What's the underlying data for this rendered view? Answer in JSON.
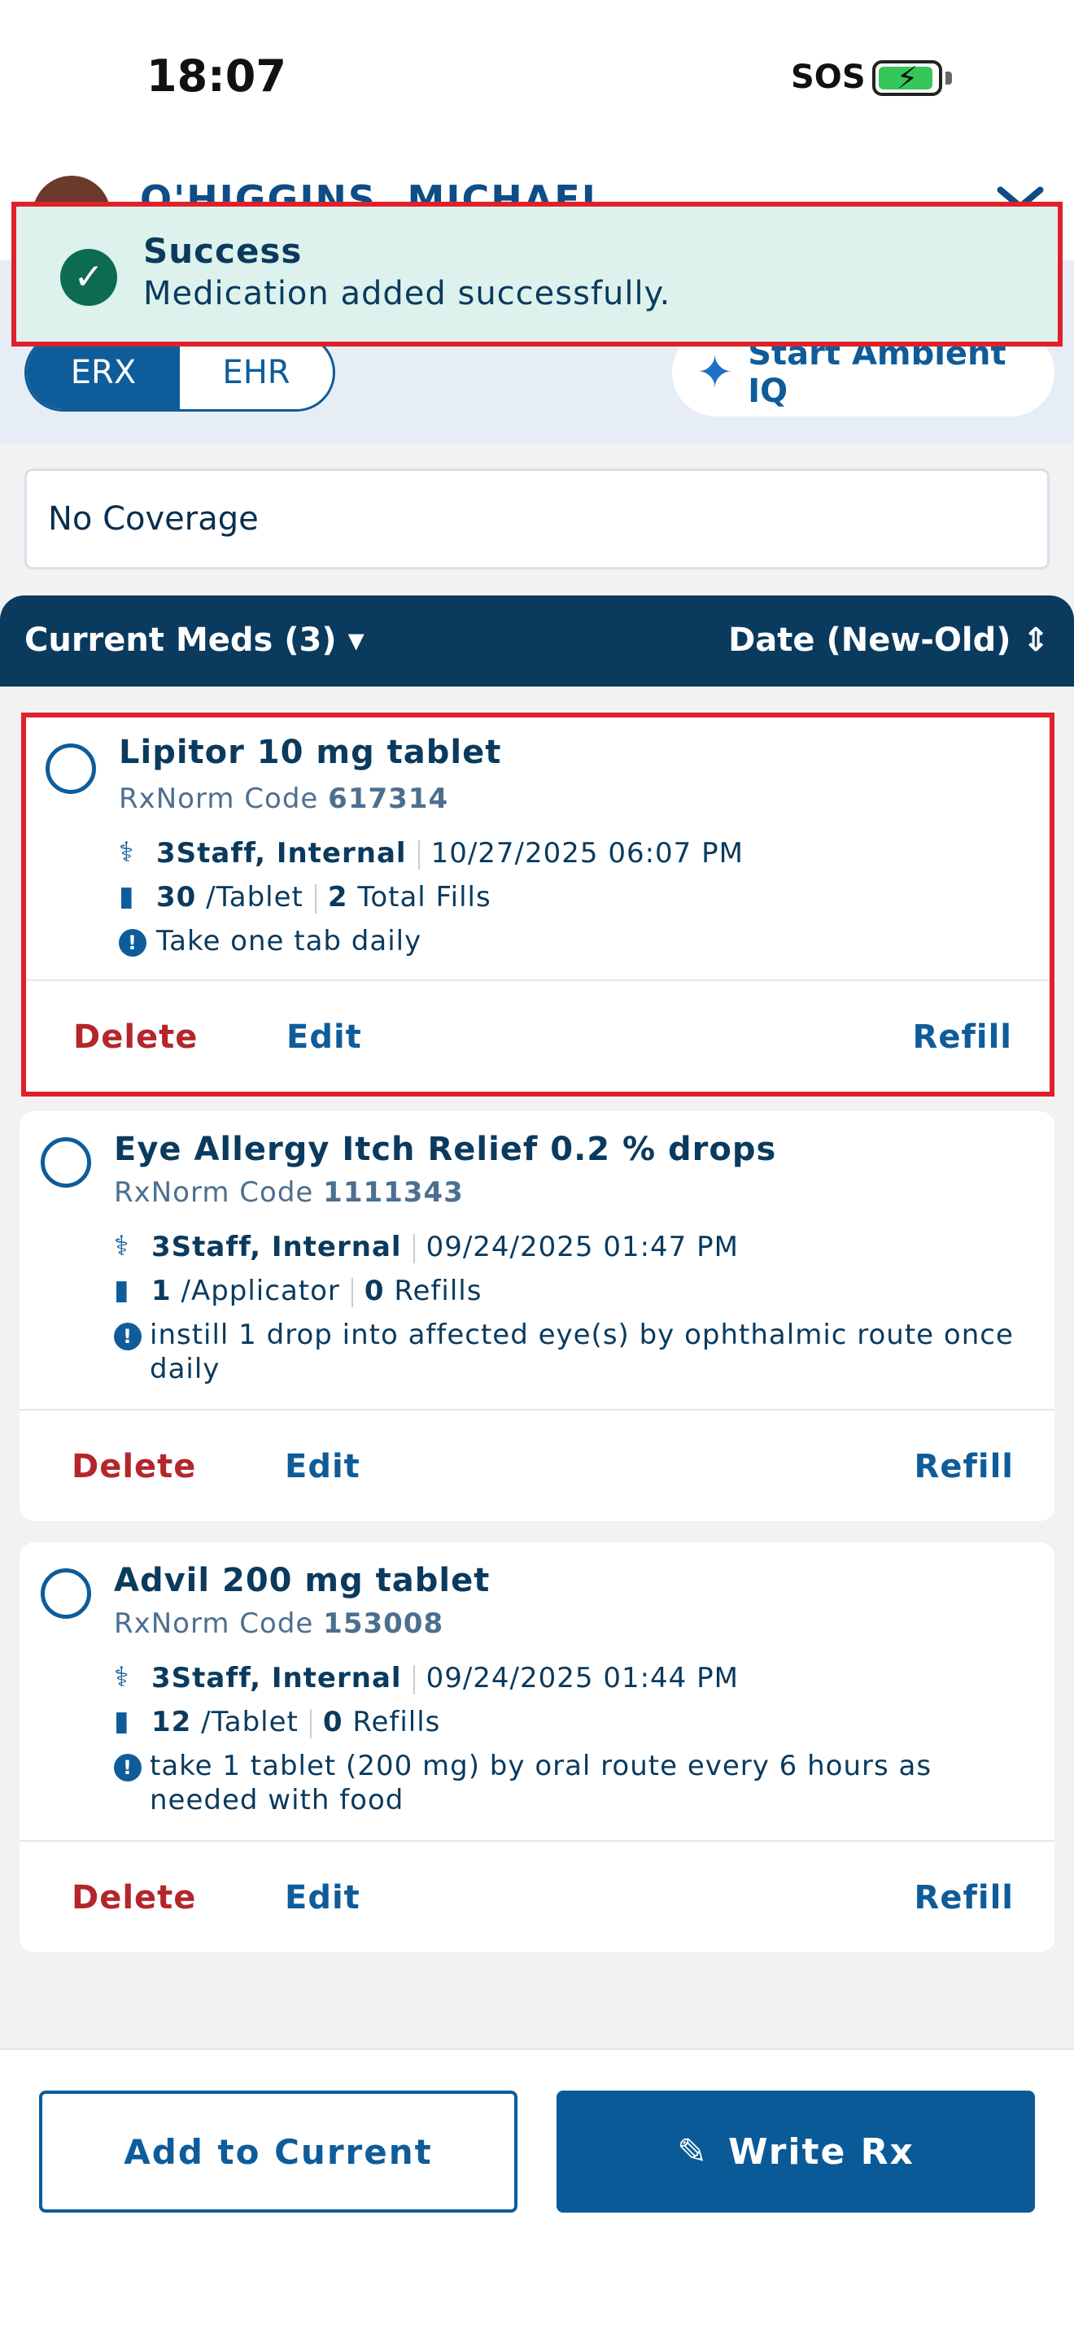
{
  "status_bar": {
    "time": "18:07",
    "sos": "SOS"
  },
  "header": {
    "patient_name": "O'HIGGINS, MICHAEL",
    "tabs": [
      {
        "label": "ERX",
        "active": true
      },
      {
        "label": "EHR",
        "active": false
      }
    ],
    "ambient_label": "Start Ambient IQ"
  },
  "coverage": "No Coverage",
  "list_header": {
    "title": "Current Meds (3)",
    "sort": "Date (New-Old)"
  },
  "meds": [
    {
      "name": "Lipitor 10 mg tablet",
      "rxnorm_label": "RxNorm Code",
      "rxnorm_code": "617314",
      "prescriber": "3Staff, Internal",
      "date": "10/27/2025 06:07 PM",
      "qty": "30",
      "unit": "/Tablet",
      "fills_num": "2",
      "fills_label": "Total Fills",
      "sig": "Take one tab daily"
    },
    {
      "name": "Eye Allergy Itch Relief 0.2 % drops",
      "rxnorm_label": "RxNorm Code",
      "rxnorm_code": "1111343",
      "prescriber": "3Staff, Internal",
      "date": "09/24/2025 01:47 PM",
      "qty": "1",
      "unit": "/Applicator",
      "fills_num": "0",
      "fills_label": "Refills",
      "sig": "instill 1 drop into affected eye(s) by ophthalmic route once daily"
    },
    {
      "name": "Advil 200 mg tablet",
      "rxnorm_label": "RxNorm Code",
      "rxnorm_code": "153008",
      "prescriber": "3Staff, Internal",
      "date": "09/24/2025 01:44 PM",
      "qty": "12",
      "unit": "/Tablet",
      "fills_num": "0",
      "fills_label": "Refills",
      "sig": "take 1 tablet (200 mg) by oral route every 6 hours as needed with food"
    }
  ],
  "actions": {
    "delete": "Delete",
    "edit": "Edit",
    "refill": "Refill"
  },
  "footer": {
    "add_label": "Add to Current",
    "write_label": "Write Rx"
  },
  "toast": {
    "title": "Success",
    "message": "Medication added successfully."
  },
  "colors": {
    "primary": "#0e5c9a",
    "navy": "#0a3a5e",
    "danger": "#b3262a",
    "toast_bg": "#ddf2ec",
    "success": "#0d6b52"
  }
}
